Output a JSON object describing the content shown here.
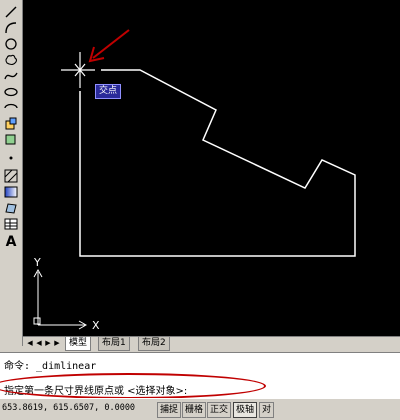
{
  "toolbar": {
    "tools": [
      {
        "icon": "line-icon"
      },
      {
        "icon": "arc-icon"
      },
      {
        "icon": "circle-icon"
      },
      {
        "icon": "revision-cloud-icon"
      },
      {
        "icon": "spline-icon"
      },
      {
        "icon": "ellipse-icon"
      },
      {
        "icon": "ellipse-arc-icon"
      },
      {
        "icon": "insert-block-icon"
      },
      {
        "icon": "make-block-icon"
      },
      {
        "icon": "point-icon"
      },
      {
        "icon": "hatch-icon"
      },
      {
        "icon": "gradient-icon"
      },
      {
        "icon": "region-icon"
      },
      {
        "icon": "table-icon"
      },
      {
        "icon": "multiline-text-icon",
        "glyph": "A"
      }
    ]
  },
  "canvas": {
    "snap_tooltip": "交点",
    "ucs": {
      "x_label": "X",
      "y_label": "Y"
    },
    "colors": {
      "background": "#000000",
      "geometry": "#ffffff",
      "annotation_arrow": "#c00000"
    }
  },
  "tabs": [
    {
      "label": "模型",
      "active": true
    },
    {
      "label": "布局1",
      "active": false
    },
    {
      "label": "布局2",
      "active": false
    }
  ],
  "command": {
    "line1": "命令: _dimlinear",
    "line2": "指定第一条尺寸界线原点或 <选择对象>:"
  },
  "status": {
    "coordinates": "653.8619, 615.6507, 0.0000",
    "buttons": [
      {
        "label": "捕捉"
      },
      {
        "label": "栅格"
      },
      {
        "label": "正交"
      },
      {
        "label": "极轴"
      },
      {
        "label": "对"
      }
    ]
  }
}
